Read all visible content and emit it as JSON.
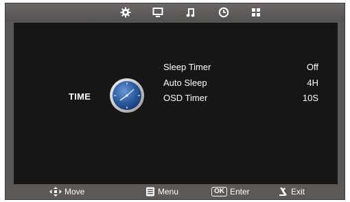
{
  "top_tabs": [
    {
      "icon": "gear-icon",
      "name": "setup"
    },
    {
      "icon": "monitor-icon",
      "name": "picture"
    },
    {
      "icon": "music-note-icon",
      "name": "sound"
    },
    {
      "icon": "clock-icon",
      "name": "time"
    },
    {
      "icon": "grid-icon",
      "name": "option"
    }
  ],
  "active_tab": "time",
  "section": {
    "title": "TIME",
    "icon": "clock-icon"
  },
  "items": [
    {
      "label": "Sleep Timer",
      "value": "Off"
    },
    {
      "label": "Auto Sleep",
      "value": "4H"
    },
    {
      "label": "OSD Timer",
      "value": "10S"
    }
  ],
  "footer": {
    "move": "Move",
    "menu": "Menu",
    "ok_key": "OK",
    "enter": "Enter",
    "exit": "Exit"
  },
  "colors": {
    "frame": "#5a5755",
    "menu_background": "#161616",
    "text": "#ffffff",
    "clock_face": "#2a5a9e"
  }
}
